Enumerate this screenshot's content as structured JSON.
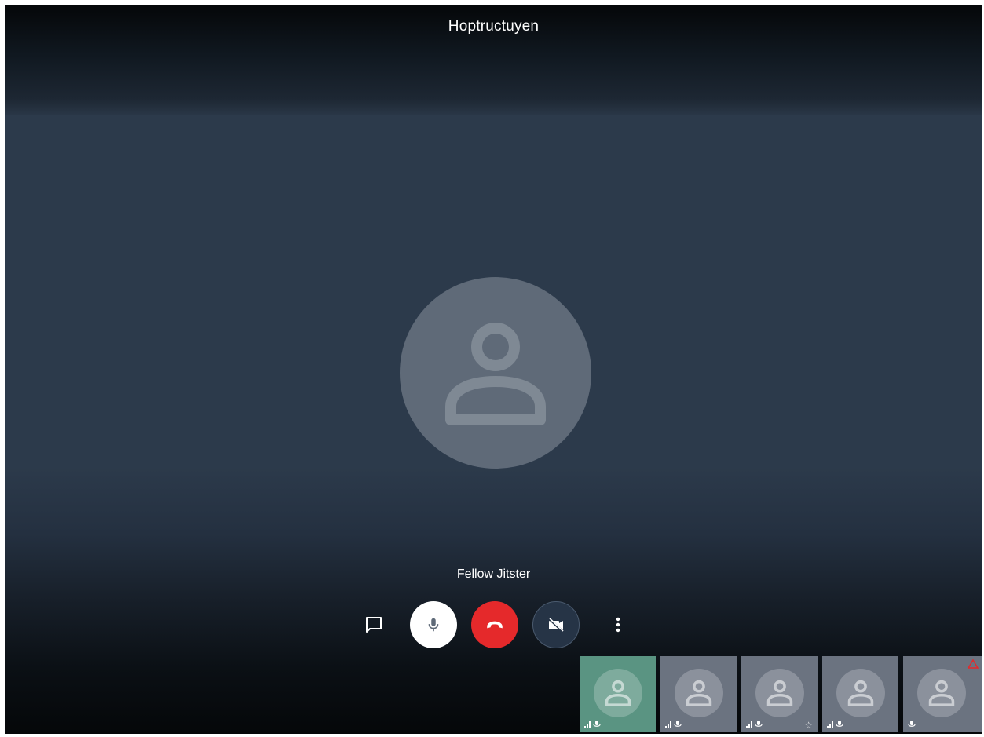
{
  "meeting": {
    "title": "Hoptructuyen"
  },
  "main_view": {
    "speaker_name": "Fellow Jitster",
    "avatar_icon": "user-avatar-icon"
  },
  "toolbar": {
    "chat_icon": "chat-icon",
    "mic_icon": "microphone-icon",
    "hangup_icon": "hangup-icon",
    "camera_icon": "camera-off-icon",
    "more_icon": "more-vertical-icon",
    "hangup_color": "#e5292b",
    "mic_button_color": "#ffffff",
    "camera_button_color": "#263446"
  },
  "filmstrip": {
    "thumbnails": [
      {
        "active": true,
        "indicators": [
          "signal-icon",
          "mic-icon"
        ],
        "starred": false,
        "warning": false,
        "background": "#5a9482"
      },
      {
        "active": false,
        "indicators": [
          "signal-icon",
          "mic-icon"
        ],
        "starred": false,
        "warning": false,
        "background": "#6b7380"
      },
      {
        "active": false,
        "indicators": [
          "signal-icon",
          "mic-icon"
        ],
        "starred": true,
        "warning": false,
        "background": "#6b7380"
      },
      {
        "active": false,
        "indicators": [
          "signal-icon",
          "mic-icon"
        ],
        "starred": false,
        "warning": false,
        "background": "#6b7380"
      },
      {
        "active": false,
        "indicators": [
          "mic-icon"
        ],
        "starred": false,
        "warning": true,
        "background": "#6b7380"
      }
    ]
  }
}
